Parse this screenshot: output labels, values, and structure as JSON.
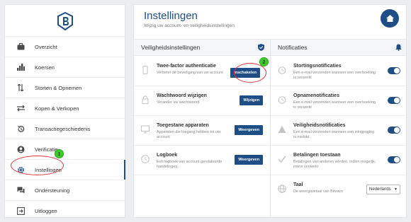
{
  "sidebar": {
    "items": [
      {
        "label": "Overzicht",
        "icon": "briefcase-icon"
      },
      {
        "label": "Koersen",
        "icon": "chart-bars-icon"
      },
      {
        "label": "Storten & Opnemen",
        "icon": "up-down-arrows-icon"
      },
      {
        "label": "Kopen & Verkopen",
        "icon": "exchange-arrows-icon"
      },
      {
        "label": "Transactiegeschiedenis",
        "icon": "history-icon"
      },
      {
        "label": "Verificatie",
        "icon": "user-icon"
      },
      {
        "label": "Instellingen",
        "icon": "gear-icon",
        "active": true
      },
      {
        "label": "Ondersteuning",
        "icon": "chat-icon"
      },
      {
        "label": "Uitloggen",
        "icon": "logout-icon"
      }
    ]
  },
  "steps": {
    "one": "1",
    "two": "2"
  },
  "header": {
    "title": "Instellingen",
    "subtitle": "Wijzig uw account- en veiligheidsinstellingen"
  },
  "security": {
    "title": "Veiligheidsinstellingen",
    "rows": [
      {
        "title": "Twee-factor authenticatie",
        "desc": "Verbeter de beveiliging van uw account",
        "button": "Inschakelen"
      },
      {
        "title": "Wachtwoord wijzigen",
        "desc": "Verander uw wachtwoord",
        "button": "Wijzigen"
      },
      {
        "title": "Toegestane apparaten",
        "desc": "Apparaten die toegang hebben tot uw account",
        "button": "Weergeven"
      },
      {
        "title": "Logboek",
        "desc": "Een logboek van account gerelateerde handelingen",
        "button": "Weergeven"
      }
    ]
  },
  "notifications": {
    "title": "Notificaties",
    "rows": [
      {
        "title": "Stortingsnotificaties",
        "desc": "Een e-mail verzenden wanneer een overboeking is verwerkt",
        "enabled": true
      },
      {
        "title": "Opnamenotificaties",
        "desc": "Een e-mail verzenden wanneer een overboeking is verwerkt",
        "enabled": true
      },
      {
        "title": "Veiligheidsnotificaties",
        "desc": "Een e-mail verzenden wanneer een inlogpoging is mislukt",
        "enabled": true
      },
      {
        "title": "Betalingen toestaan",
        "desc": "Betalingen van anderen worden, indien mogelijk, intern verwerkt",
        "enabled": true
      }
    ],
    "language": {
      "title": "Taal",
      "desc": "De weergavetaal van Bitvavo",
      "value": "Nederlands"
    }
  },
  "colors": {
    "brand": "#1f4d86",
    "highlight": "#e03336",
    "step_badge": "#3dcb2c"
  }
}
